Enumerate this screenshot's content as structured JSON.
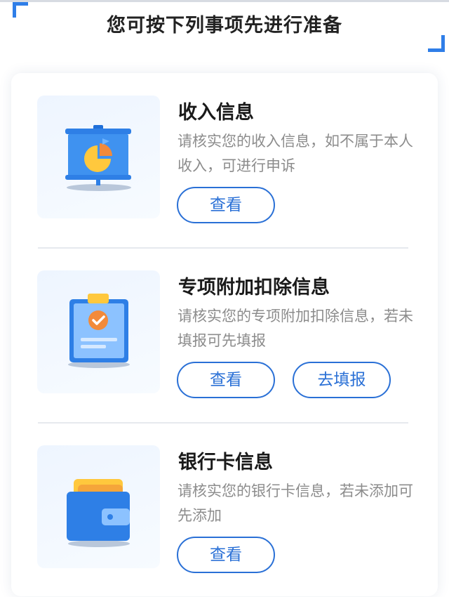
{
  "header": {
    "title": "您可按下列事项先进行准备"
  },
  "cards": [
    {
      "icon": "presentation-pie-chart-icon",
      "title": "收入信息",
      "description": "请核实您的收入信息，如不属于本人收入，可进行申诉",
      "buttons": [
        "查看"
      ]
    },
    {
      "icon": "clipboard-check-icon",
      "title": "专项附加扣除信息",
      "description": "请核实您的专项附加扣除信息，若未填报可先填报",
      "buttons": [
        "查看",
        "去填报"
      ]
    },
    {
      "icon": "wallet-card-icon",
      "title": "银行卡信息",
      "description": "请核实您的银行卡信息，若未添加可先添加",
      "buttons": [
        "查看"
      ]
    }
  ],
  "colors": {
    "accent": "#2a70d6",
    "corner": "#2f7ee8",
    "title_text": "#1a1a1a",
    "desc_text": "#8c8c8c",
    "divider": "#e6e9ee"
  }
}
